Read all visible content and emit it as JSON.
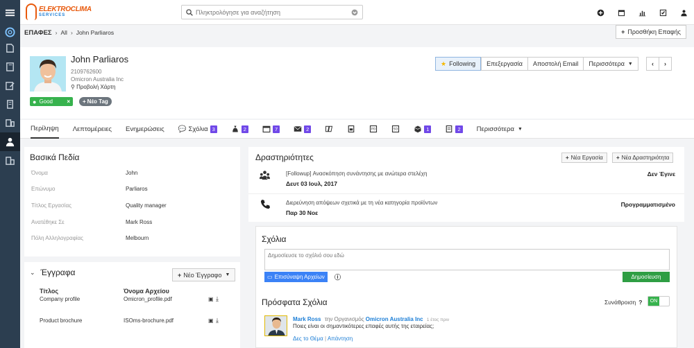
{
  "brand": {
    "name_top": "ELEKTROCLIMA",
    "name_bottom": "SERVICES",
    "color": "#e8590c"
  },
  "search": {
    "placeholder": "Πληκτρολόγησε για αναζήτηση"
  },
  "topbar_icons": [
    "plus-circle-icon",
    "calendar-icon",
    "bar-chart-icon",
    "checkbox-icon",
    "user-icon"
  ],
  "sidebar": [
    "menu-icon",
    "support-icon",
    "tickets-icon",
    "notebook-icon",
    "edit-icon",
    "building-icon",
    "mobile-icon",
    "contacts-icon",
    "companies-icon"
  ],
  "breadcrumb": {
    "section": "ΕΠΑΦΕΣ",
    "all": "All",
    "current": "John Parliaros"
  },
  "add_contact": "Προσθήκη Επαφής",
  "profile": {
    "name": "John Parliaros",
    "phone": "2109762600",
    "company": "Omicron Australia Inc",
    "map_link": "Προβολή Χάρτη",
    "status_tag": "Good",
    "new_tag": "Νέο Tag",
    "actions": {
      "following": "Following",
      "edit": "Επεξεργασία",
      "email": "Αποστολή Email",
      "more": "Περισσότερα"
    }
  },
  "tabs": {
    "summary": "Περίληψη",
    "details": "Λεπτομέρειες",
    "updates": "Ενημερώσεις",
    "comments": "Σχόλια",
    "comments_count": "3",
    "money_count": "2",
    "calendar_count": "7",
    "email_count": "2",
    "box_count": "1",
    "docs_count": "2",
    "more": "Περισσότερα"
  },
  "basic_fields": {
    "title": "Βασικά Πεδία",
    "rows": [
      {
        "label": "Όνομα",
        "value": "John"
      },
      {
        "label": "Επώνυμο",
        "value": "Parliaros"
      },
      {
        "label": "Τίτλος Εργασίας",
        "value": "Quality manager"
      },
      {
        "label": "Ανατέθηκε Σε",
        "value": "Mark Ross"
      },
      {
        "label": "Πόλη Αλληλογραφίας",
        "value": "Melbourn"
      }
    ]
  },
  "documents": {
    "title": "Έγγραφα",
    "new_button": "Νέο Έγγραφο",
    "col_title": "Τίτλος",
    "col_file": "Όνομα Αρχείου",
    "rows": [
      {
        "title": "Company profile",
        "file": "Omicron_profile.pdf"
      },
      {
        "title": "Product brochure",
        "file": "ISOms-brochure.pdf"
      }
    ]
  },
  "activities": {
    "title": "Δραστηριότητες",
    "new_task": "Νέα Εργασία",
    "new_activity": "Νέα Δραστηριότητα",
    "items": [
      {
        "icon": "meeting-icon",
        "text": "[Followup] Ανασκόπηση συνάντησης με ανώτερα στελέχη",
        "date": "Δευτ 03 Ιουλ, 2017",
        "status": "Δεν Έγινε"
      },
      {
        "icon": "phone-icon",
        "text": "Διερεύνηση απόψεων σχετικά με τη νέα κατηγορία προϊόντων",
        "date": "Παρ 30 Νοε",
        "status": "Προγραμματισμένο"
      }
    ]
  },
  "comments": {
    "title": "Σχόλια",
    "placeholder": "Δημοσίευσε το σχόλιό σου εδώ",
    "upload": "Επισύναψη Αρχείων",
    "publish": "Δημοσίευση"
  },
  "recent": {
    "title": "Πρόσφατα Σχόλια",
    "aggregate_label": "Συνάθροιση",
    "toggle": "ON",
    "author": "Mark Ross",
    "in_org": "την Οργανισμός",
    "org": "Omicron Australia Inc",
    "ago": "1 έτος πριν",
    "text": "Ποιες είναι οι σημαντικότερες επαφές αυτής της εταιρείας;",
    "view_topic": "Δες το Θέμα",
    "reply": "Απάντηση"
  }
}
